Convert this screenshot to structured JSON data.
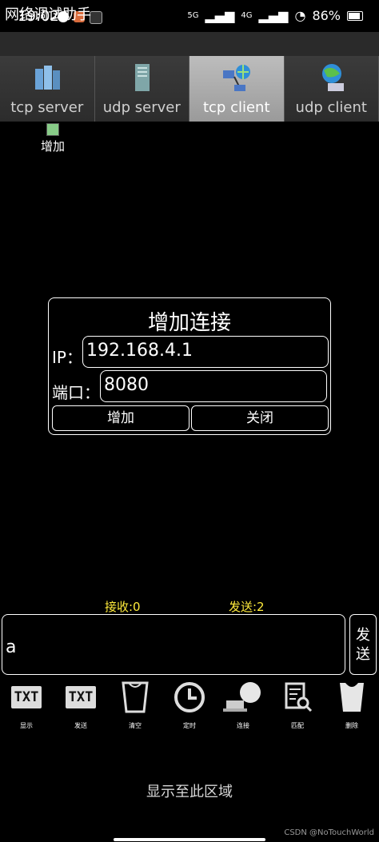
{
  "status": {
    "time": "19:02",
    "net1": "5G",
    "net2": "4G",
    "battery": "86%"
  },
  "app": {
    "title": "网络调试助手"
  },
  "tabs": [
    {
      "label": "tcp server"
    },
    {
      "label": "udp server"
    },
    {
      "label": "tcp client",
      "active": true
    },
    {
      "label": "udp client"
    }
  ],
  "shortcut": {
    "label": "增加"
  },
  "dialog": {
    "title": "增加连接",
    "ip_label": "IP：",
    "ip_value": "192.168.4.1",
    "port_label": "端口：",
    "port_value": "8080",
    "add_label": "增加",
    "close_label": "关闭"
  },
  "counters": {
    "receive": "接收:0",
    "send": "发送:2"
  },
  "input": {
    "value": "a"
  },
  "send_button": {
    "label_line1": "发",
    "label_line2": "送"
  },
  "toolbar": {
    "txt_text": "TXT",
    "items": [
      "显示",
      "发送",
      "清空",
      "定时",
      "连接",
      "匹配",
      "删除"
    ]
  },
  "bottom": {
    "label": "显示至此区域"
  },
  "watermark": "CSDN @NoTouchWorld",
  "colors": {
    "counter": "#ffeb3b",
    "active_tab": "#b0b0b0"
  }
}
